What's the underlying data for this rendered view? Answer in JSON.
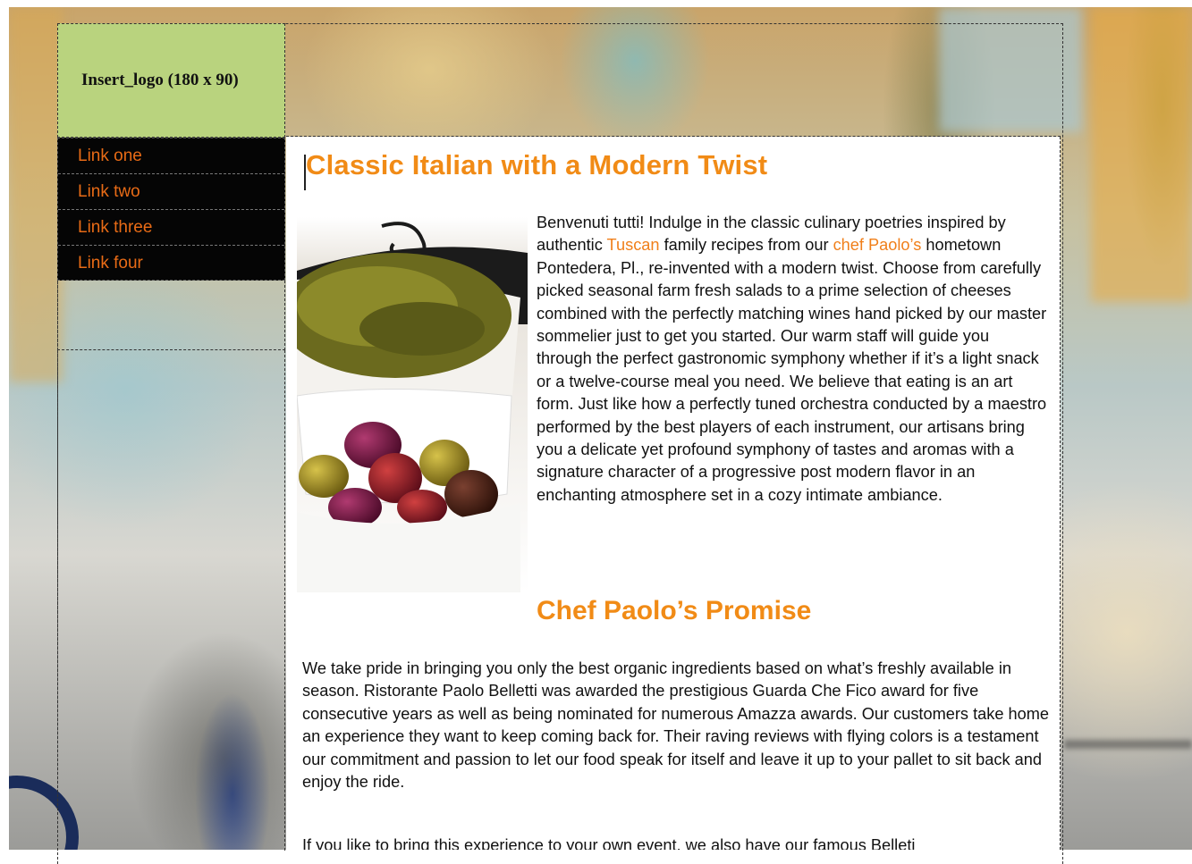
{
  "logo": {
    "text": "Insert_logo (180 x 90)"
  },
  "nav": {
    "items": [
      {
        "label": "Link one"
      },
      {
        "label": "Link two"
      },
      {
        "label": "Link three"
      },
      {
        "label": "Link four"
      }
    ]
  },
  "main": {
    "title": "Classic Italian with a Modern Twist",
    "intro": {
      "part1": "Benvenuti tutti! Indulge in the classic culinary poetries inspired by authentic ",
      "link1": "Tuscan",
      "part2": " family recipes from our ",
      "link2": "chef Paolo’s",
      "part3": " hometown Pontedera, Pl., re-invented with a modern twist.  Choose from carefully picked seasonal farm fresh salads to a prime selection of cheeses combined with the perfectly matching wines hand picked by our master sommelier just to get you started.  Our warm staff will guide you through the perfect gastronomic symphony whether if it’s a light snack or a twelve-course meal you need.  We believe that eating is an art form.  Just like how a perfectly tuned orchestra conducted by a maestro performed by the best players of each instrument, our artisans bring you a delicate yet profound symphony of tastes and aromas with a signature character of a progressive post modern flavor in an enchanting atmosphere set in a cozy intimate ambiance."
    },
    "subtitle": "Chef Paolo’s Promise",
    "promise": "We take pride in bringing you only the best organic ingredients based on what’s freshly available in season.  Ristorante Paolo Belletti was awarded the prestigious Guarda Che Fico award for five consecutive years as well as being nominated for numerous Amazza awards.  Our customers take home an experience they want to keep coming back for.  Their raving reviews with flying colors is a testament our commitment and passion to let our food speak for itself and leave it up to your pallet to sit back and enjoy the ride.",
    "event": "If you like to bring this experience to your own event, we also have our famous Belleti"
  },
  "colors": {
    "accent": "#f18b16",
    "logo_bg": "#b9d37e",
    "nav_bg": "#050505",
    "nav_text": "#e86b16"
  },
  "icons": {
    "image": "food-photo-olives-bowl"
  }
}
